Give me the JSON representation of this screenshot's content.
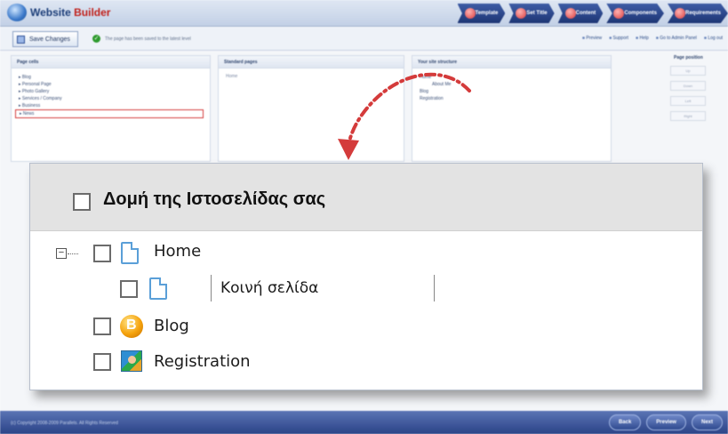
{
  "app": {
    "logo_prefix": "Website ",
    "logo_brand": "Builder",
    "steps": [
      "Template",
      "Set Title",
      "Content",
      "Components",
      "Requirements"
    ]
  },
  "toolbar": {
    "save_label": "Save Changes",
    "status_text": "The page has been saved to the latest level",
    "links": [
      "Preview",
      "Support",
      "Help",
      "Go to Admin Panel",
      "Log out"
    ]
  },
  "panels": {
    "page_cells_title": "Page cells",
    "page_cells": [
      "Blog",
      "Personal Page",
      "Photo Gallery",
      "Services / Company",
      "Business",
      "News"
    ],
    "standard_pages_title": "Standard pages",
    "standard_pages": [
      "Home"
    ],
    "structure_title": "Your site structure",
    "structure_items": [
      "Home",
      "About Me",
      "Blog",
      "Registration"
    ],
    "position_title": "Page position",
    "position_buttons": [
      "Up",
      "Down",
      "Left",
      "Right"
    ]
  },
  "footer": {
    "copyright": "(c) Copyright 2008-2009 Parallels. All Rights Reserved",
    "nav": [
      "Back",
      "Preview",
      "Next"
    ]
  },
  "zoom": {
    "title": "Δομή της Ιστοσελίδας σας",
    "tree": {
      "home": "Home",
      "child_edit_value": "Κοινή σελίδα",
      "blog": "Blog",
      "registration": "Registration"
    }
  },
  "icons": [
    "globe-icon",
    "step-icon",
    "save-icon",
    "checkmark-icon",
    "page-icon",
    "blog-icon",
    "registration-icon",
    "expand-icon",
    "arrow-icon"
  ],
  "colors": {
    "accent_red": "#d43b3b",
    "nav_blue": "#2b4387",
    "page_icon_blue": "#5a9fd8"
  }
}
